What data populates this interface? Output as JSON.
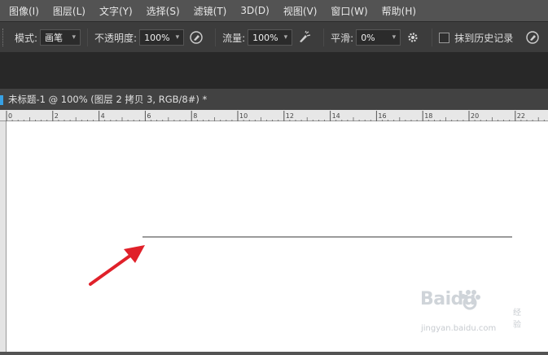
{
  "menu": [
    "图像(I)",
    "图层(L)",
    "文字(Y)",
    "选择(S)",
    "滤镜(T)",
    "3D(D)",
    "视图(V)",
    "窗口(W)",
    "帮助(H)"
  ],
  "options": {
    "mode_label": "模式:",
    "mode_value": "画笔",
    "opacity_label": "不透明度:",
    "opacity_value": "100%",
    "flow_label": "流量:",
    "flow_value": "100%",
    "smoothing_label": "平滑:",
    "smoothing_value": "0%",
    "history_label": "抹到历史记录",
    "history_checked": false
  },
  "document": {
    "tab_title": "未标题-1 @ 100% (图层 2 拷贝 3, RGB/8#) *"
  },
  "ruler": {
    "labels": [
      "0",
      "2",
      "4",
      "6",
      "8",
      "10",
      "12",
      "14",
      "16",
      "18",
      "20",
      "22"
    ]
  },
  "watermark": {
    "brand": "Baidu",
    "sub": "经验",
    "url": "jingyan.baidu.com"
  },
  "colors": {
    "arrow": "#e0212a",
    "line": "#7a7a7a",
    "tab_accent": "#37a1e4"
  }
}
